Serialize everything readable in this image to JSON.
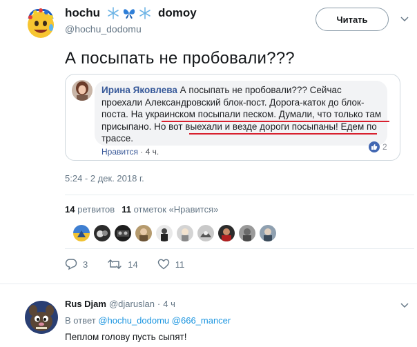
{
  "author": {
    "name_part1": "hochu",
    "name_emoji": [
      "snowflake",
      "butterfly",
      "snowflake"
    ],
    "name_part2": "domoy",
    "handle": "@hochu_dodomu",
    "follow_label": "Читать"
  },
  "tweet": {
    "text": "А посыпать не пробовали???",
    "timestamp": "5:24 - 2 дек. 2018 г."
  },
  "quote": {
    "author": "Ирина Яковлева",
    "text": "А посыпать не пробовали??? Сейчас проехали Александровский блок-пост. Дорога-каток до блок-поста. На украинском посыпали песком. Думали, что только там присыпано. Но вот выехали и везде дороги посыпаны! Едем по трассе.",
    "like_label": "Нравится",
    "age": "4 ч.",
    "reaction_count": "2"
  },
  "stats": {
    "retweets_count": "14",
    "retweets_label": "ретвитов",
    "likes_count": "11",
    "likes_label": "отметок «Нравится»"
  },
  "actions": {
    "replies": "3",
    "retweets": "14",
    "likes": "11"
  },
  "reply": {
    "name": "Rus Djam",
    "handle": "@djaruslan",
    "dot": "·",
    "age": "4 ч",
    "reply_prefix": "В ответ",
    "mention1": "@hochu_dodomu",
    "mention2": "@666_mancer",
    "text": "Пеплом голову пусть сыпят!"
  },
  "colors": {
    "link_blue": "#1b95e0",
    "muted": "#657786",
    "underline_red": "#d8202e",
    "fb_blue": "#4267b2"
  }
}
